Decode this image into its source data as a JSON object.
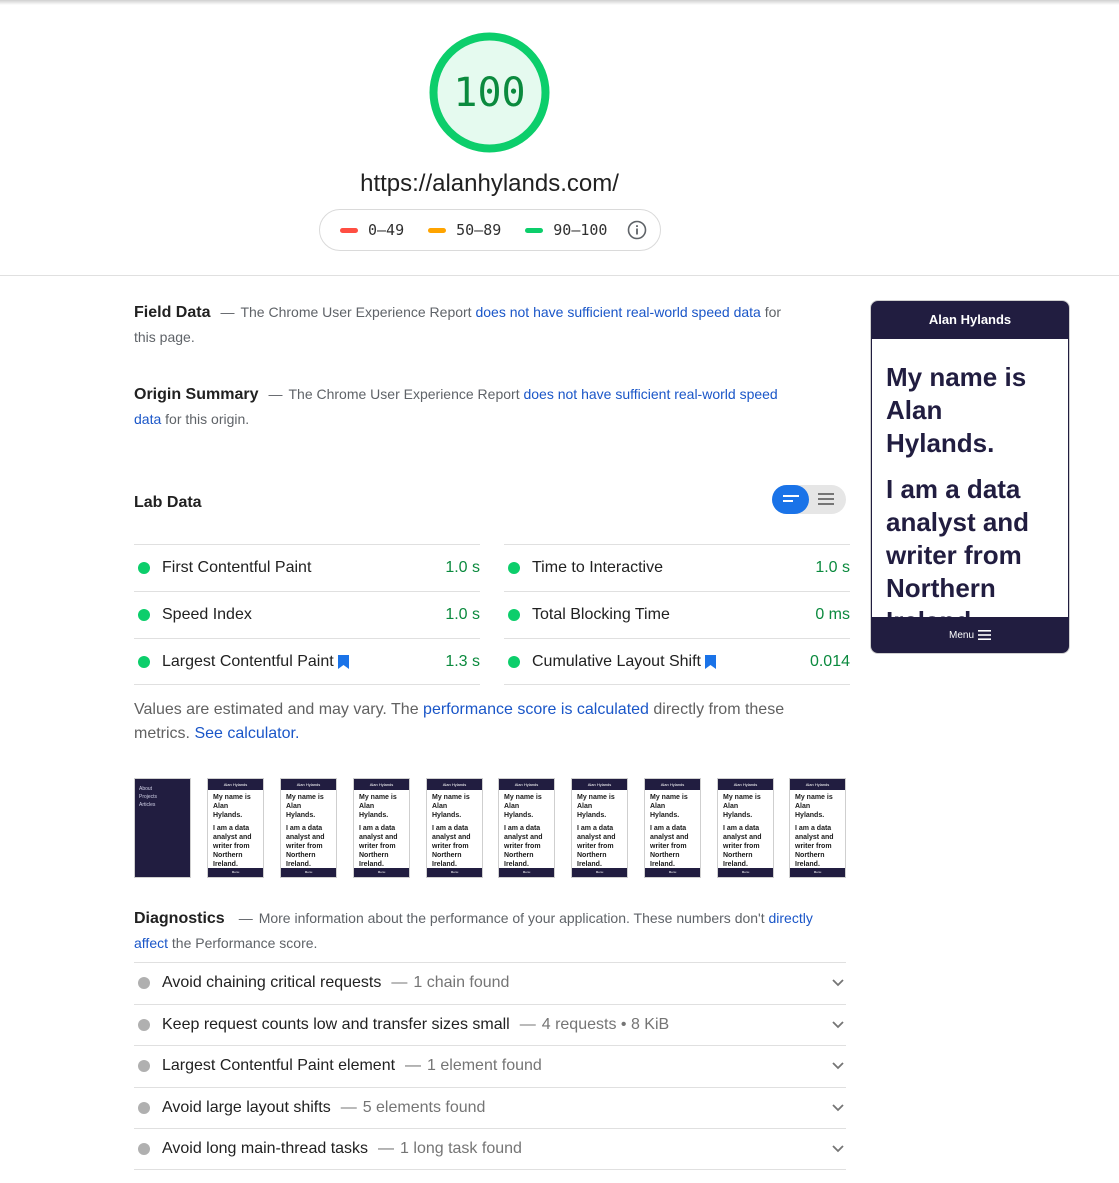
{
  "score": {
    "value": "100",
    "color": "#0cce6b",
    "fill": "#e5faef",
    "url": "https://alanhylands.com/",
    "legend": [
      {
        "label": "0–49",
        "color": "#ff4e42"
      },
      {
        "label": "50–89",
        "color": "#ffa400"
      },
      {
        "label": "90–100",
        "color": "#0cce6b"
      }
    ],
    "legend_icon": "info-icon"
  },
  "field_data": {
    "title": "Field Data",
    "dash": "—",
    "text_before": "The Chrome User Experience Report",
    "link": "does not have sufficient real-world speed data",
    "text_after": "for this page."
  },
  "origin_summary": {
    "title": "Origin Summary",
    "dash": "—",
    "text_before": "The Chrome User Experience Report",
    "link": "does not have sufficient real-world speed data",
    "text_after": "for this origin."
  },
  "lab_data": {
    "title": "Lab Data",
    "toggle_icons": [
      "summary-view-icon",
      "list-view-icon"
    ],
    "metrics_left": [
      {
        "label": "First Contentful Paint",
        "value": "1.0 s",
        "lcp_badge": false
      },
      {
        "label": "Speed Index",
        "value": "1.0 s",
        "lcp_badge": false
      },
      {
        "label": "Largest Contentful Paint",
        "value": "1.3 s",
        "lcp_badge": true
      }
    ],
    "metrics_right": [
      {
        "label": "Time to Interactive",
        "value": "1.0 s",
        "lcp_badge": false
      },
      {
        "label": "Total Blocking Time",
        "value": "0 ms",
        "lcp_badge": false
      },
      {
        "label": "Cumulative Layout Shift",
        "value": "0.014",
        "lcp_badge": true
      }
    ],
    "note_before": "Values are estimated and may vary. The",
    "note_link1": "performance score is calculated",
    "note_middle": "directly from these metrics.",
    "note_link2": "See calculator."
  },
  "filmstrip": {
    "first_frame_items": [
      "About",
      "Projects",
      "Articles"
    ],
    "frame_header": "Alan Hylands",
    "frame_text": "My name is Alan Hylands.",
    "frame_text2": "I am a data analyst and writer from Northern Ireland.",
    "frame_footer": "Menu"
  },
  "diagnostics": {
    "title": "Diagnostics",
    "dash": "—",
    "text_before": "More information about the performance of your application. These numbers don't",
    "link": "directly affect",
    "text_after": "the Performance score.",
    "items": [
      {
        "title": "Avoid chaining critical requests",
        "detail": "1 chain found"
      },
      {
        "title": "Keep request counts low and transfer sizes small",
        "detail": "4 requests • 8 KiB"
      },
      {
        "title": "Largest Contentful Paint element",
        "detail": "1 element found"
      },
      {
        "title": "Avoid large layout shifts",
        "detail": "5 elements found"
      },
      {
        "title": "Avoid long main-thread tasks",
        "detail": "1 long task found"
      }
    ]
  },
  "phone": {
    "header": "Alan Hylands",
    "heading": "My name is Alan Hylands.",
    "subheading": "I am a data analyst and writer from Northern Ireland.",
    "footer": "Menu"
  }
}
